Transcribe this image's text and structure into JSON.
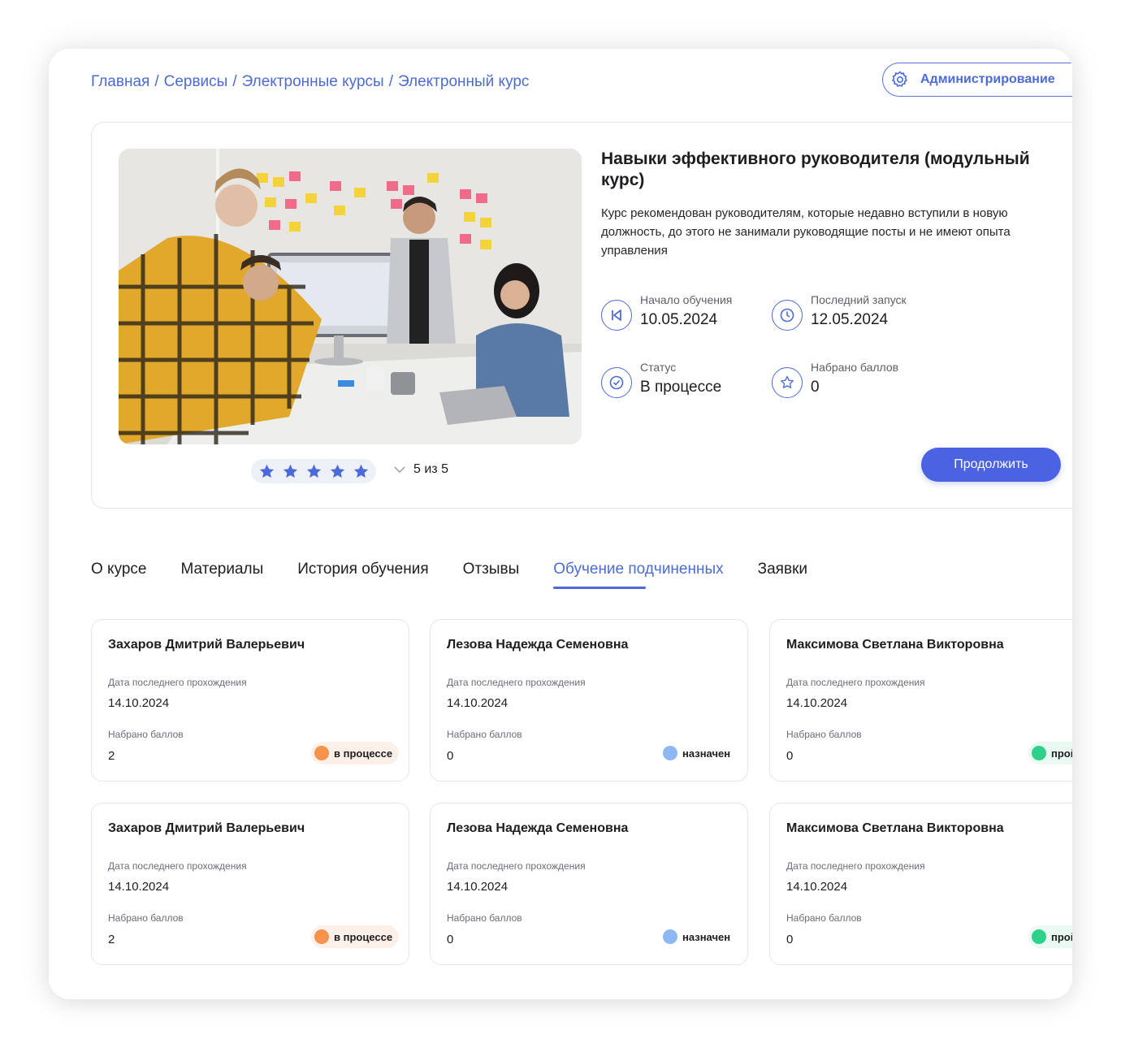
{
  "breadcrumb": [
    "Главная",
    "Сервисы",
    "Электронные курсы",
    "Электронный курс"
  ],
  "admin": {
    "label": "Администрирование",
    "icon": "gear-icon"
  },
  "course": {
    "title": "Навыки эффективного руководителя (модульный курс)",
    "description": "Курс рекомендован руководителям, которые недавно вступили в новую должность, до этого не занимали руководящие посты и не имеют опыта управления",
    "rating": {
      "stars": 5,
      "text": "5 из 5"
    },
    "meta": [
      {
        "label": "Начало обучения",
        "value": "10.05.2024",
        "icon": "skip-back-icon"
      },
      {
        "label": "Последний запуск",
        "value": "12.05.2024",
        "icon": "clock-icon"
      },
      {
        "label": "Статус",
        "value": "В процессе",
        "icon": "check-circle-icon"
      },
      {
        "label": "Набрано баллов",
        "value": "0",
        "icon": "star-icon"
      }
    ],
    "continue_label": "Продолжить"
  },
  "tabs": [
    {
      "label": "О курсе",
      "active": false
    },
    {
      "label": "Материалы",
      "active": false
    },
    {
      "label": "История обучения",
      "active": false
    },
    {
      "label": "Отзывы",
      "active": false
    },
    {
      "label": "Обучение подчиненных",
      "active": true
    },
    {
      "label": "Заявки",
      "active": false
    }
  ],
  "subordinates": [
    {
      "name": "Захаров Дмитрий Валерьевич",
      "date_label": "Дата последнего прохождения",
      "date": "14.10.2024",
      "score_label": "Набрано баллов",
      "score": "2",
      "status": "в процессе",
      "status_color": "#f5934a",
      "badge_bg": "#fdf0e8"
    },
    {
      "name": "Лезова Надежда Семеновна",
      "date_label": "Дата последнего прохождения",
      "date": "14.10.2024",
      "score_label": "Набрано баллов",
      "score": "0",
      "status": "назначен",
      "status_color": "#8db8f2",
      "badge_bg": "#ffffff"
    },
    {
      "name": "Максимова Светлана Викторовна",
      "date_label": "Дата последнего прохождения",
      "date": "14.10.2024",
      "score_label": "Набрано баллов",
      "score": "0",
      "status": "пройден",
      "status_color": "#2fd08a",
      "badge_bg": "#e8faf1"
    },
    {
      "name": "Захаров Дмитрий Валерьевич",
      "date_label": "Дата последнего прохождения",
      "date": "14.10.2024",
      "score_label": "Набрано баллов",
      "score": "2",
      "status": "в процессе",
      "status_color": "#f5934a",
      "badge_bg": "#fdf0e8"
    },
    {
      "name": "Лезова Надежда Семеновна",
      "date_label": "Дата последнего прохождения",
      "date": "14.10.2024",
      "score_label": "Набрано баллов",
      "score": "0",
      "status": "назначен",
      "status_color": "#8db8f2",
      "badge_bg": "#ffffff"
    },
    {
      "name": "Максимова Светлана Викторовна",
      "date_label": "Дата последнего прохождения",
      "date": "14.10.2024",
      "score_label": "Набрано баллов",
      "score": "0",
      "status": "пройден",
      "status_color": "#2fd08a",
      "badge_bg": "#e8faf1"
    }
  ],
  "colors": {
    "accent": "#4c6bd6",
    "button": "#4b63e0",
    "border": "#e3e5ec"
  }
}
